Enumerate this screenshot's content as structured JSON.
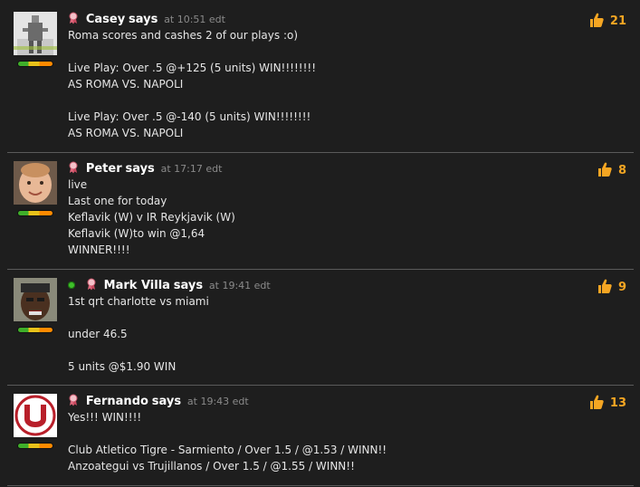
{
  "colors": {
    "accent_like": "#f5a623",
    "online": "#3fbf2a",
    "timestamp": "#8a8a8a"
  },
  "posts": [
    {
      "author": "Casey",
      "says": "says",
      "time": "at 10:51 edt",
      "likes": "21",
      "online": false,
      "lines": [
        "Roma scores and cashes 2 of our plays :o)",
        "",
        "Live Play: Over .5 @+125 (5 units) WIN!!!!!!!!",
        "AS ROMA VS. NAPOLI",
        "",
        "Live Play: Over .5 @-140 (5 units) WIN!!!!!!!!",
        "AS ROMA VS. NAPOLI"
      ]
    },
    {
      "author": "Peter",
      "says": "says",
      "time": "at 17:17 edt",
      "likes": "8",
      "online": false,
      "lines": [
        "live",
        "Last one for today",
        "Keflavik (W) v IR Reykjavik (W)",
        "Keflavik (W)to win @1,64",
        "WINNER!!!!"
      ]
    },
    {
      "author": "Mark Villa",
      "says": "says",
      "time": "at 19:41 edt",
      "likes": "9",
      "online": true,
      "lines": [
        "1st qrt charlotte vs miami",
        "",
        "under 46.5",
        "",
        "5 units @$1.90 WIN"
      ]
    },
    {
      "author": "Fernando",
      "says": "says",
      "time": "at 19:43 edt",
      "likes": "13",
      "online": false,
      "lines": [
        "Yes!!! WIN!!!!",
        "",
        "Club Atletico Tigre - Sarmiento / Over 1.5 / @1.53 / WINN!!",
        "Anzoategui vs Trujillanos / Over 1.5 / @1.55 / WINN!!"
      ]
    }
  ]
}
